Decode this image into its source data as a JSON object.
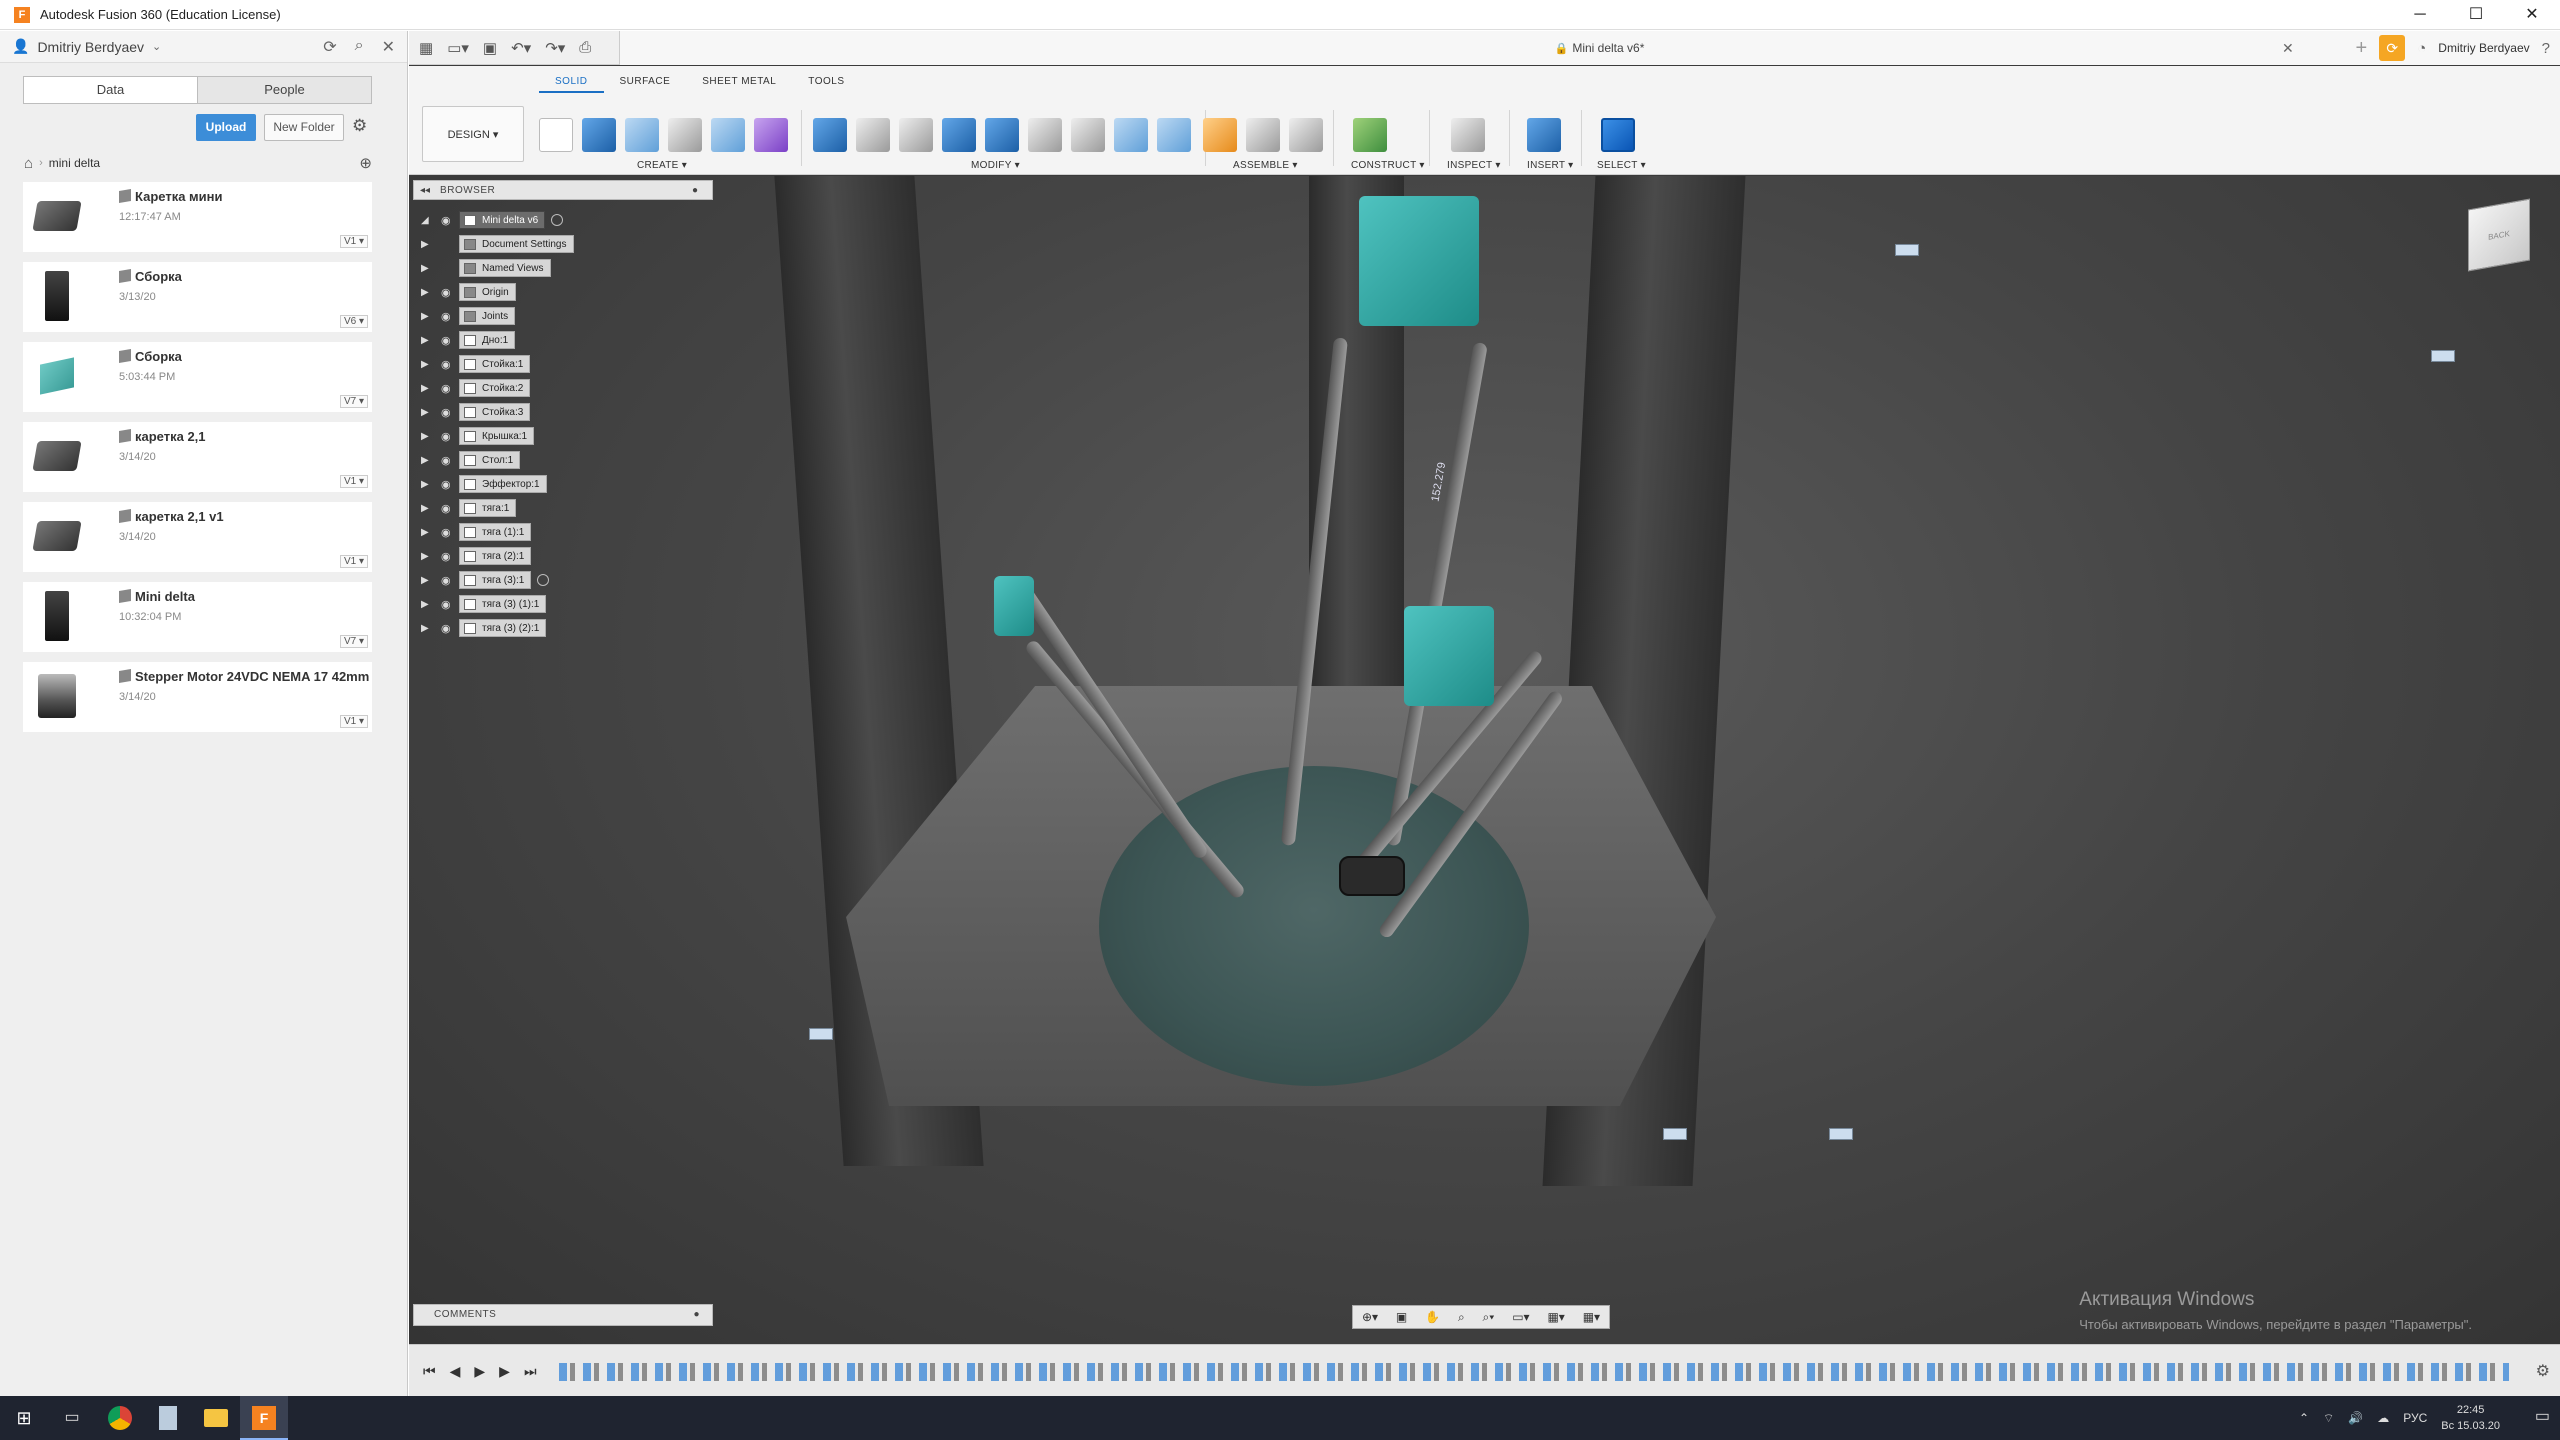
{
  "window": {
    "title": "Autodesk Fusion 360 (Education License)",
    "minimize": "─",
    "maximize": "☐",
    "close": "✕"
  },
  "data_panel": {
    "user_name": "Dmitriy Berdyaev",
    "tabs": [
      "Data",
      "People"
    ],
    "upload_label": "Upload",
    "new_folder_label": "New Folder",
    "breadcrumb_folder": "mini delta",
    "files": [
      {
        "name": "Каретка мини",
        "date": "12:17:47 AM",
        "version": "V1 ▾",
        "thumb": "box"
      },
      {
        "name": "Сборка",
        "date": "3/13/20",
        "version": "V6 ▾",
        "thumb": "tall"
      },
      {
        "name": "Сборка",
        "date": "5:03:44 PM",
        "version": "V7 ▾",
        "thumb": "teal"
      },
      {
        "name": "каретка 2,1",
        "date": "3/14/20",
        "version": "V1 ▾",
        "thumb": "box"
      },
      {
        "name": "каретка 2,1 v1",
        "date": "3/14/20",
        "version": "V1 ▾",
        "thumb": "box"
      },
      {
        "name": "Mini delta",
        "date": "10:32:04 PM",
        "version": "V7 ▾",
        "thumb": "tall"
      },
      {
        "name": "Stepper Motor 24VDC NEMA 17 42mm",
        "date": "3/14/20",
        "version": "V1 ▾",
        "thumb": "motor"
      }
    ]
  },
  "document": {
    "tab_name": "Mini delta v6*",
    "user_name": "Dmitriy Berdyaev"
  },
  "toolbar": {
    "workspace_button": "DESIGN ▾",
    "tabs": [
      "SOLID",
      "SURFACE",
      "SHEET METAL",
      "TOOLS"
    ],
    "groups": [
      "CREATE ▾",
      "MODIFY ▾",
      "ASSEMBLE ▾",
      "CONSTRUCT ▾",
      "INSPECT ▾",
      "INSERT ▾",
      "SELECT ▾"
    ]
  },
  "browser": {
    "title": "BROWSER",
    "root": "Mini delta v6",
    "items": [
      {
        "label": "Document Settings",
        "icon": "gear"
      },
      {
        "label": "Named Views",
        "icon": "folder"
      },
      {
        "label": "Origin",
        "icon": "folder"
      },
      {
        "label": "Joints",
        "icon": "folder"
      },
      {
        "label": "Дно:1",
        "icon": "comp"
      },
      {
        "label": "Стойка:1",
        "icon": "comp"
      },
      {
        "label": "Стойка:2",
        "icon": "comp"
      },
      {
        "label": "Стойка:3",
        "icon": "comp"
      },
      {
        "label": "Крышка:1",
        "icon": "comp"
      },
      {
        "label": "Стол:1",
        "icon": "comp"
      },
      {
        "label": "Эффектор:1",
        "icon": "comp"
      },
      {
        "label": "тяга:1",
        "icon": "comp"
      },
      {
        "label": "тяга (1):1",
        "icon": "comp"
      },
      {
        "label": "тяга (2):1",
        "icon": "comp"
      },
      {
        "label": "тяга (3):1",
        "icon": "comp"
      },
      {
        "label": "тяга (3) (1):1",
        "icon": "comp"
      },
      {
        "label": "тяга (3) (2):1",
        "icon": "comp"
      }
    ]
  },
  "viewport": {
    "dimension_label": "152.279",
    "viewcube_label": "BACK",
    "activation_title": "Активация Windows",
    "activation_text": "Чтобы активировать Windows, перейдите в раздел \"Параметры\"."
  },
  "comments": {
    "title": "COMMENTS"
  },
  "taskbar": {
    "lang": "РУС",
    "time": "22:45",
    "date": "Вс 15.03.20"
  }
}
